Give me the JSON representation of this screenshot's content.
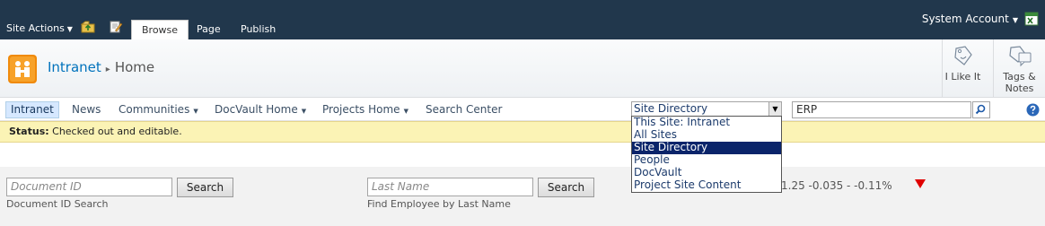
{
  "ribbon": {
    "site_actions": "Site Actions",
    "tabs": [
      "Browse",
      "Page",
      "Publish"
    ],
    "account": "System Account"
  },
  "title": {
    "site": "Intranet",
    "separator": "▸",
    "page": "Home",
    "i_like_it": "I Like It",
    "tags_notes": "Tags & Notes"
  },
  "nav": {
    "items": [
      "Intranet",
      "News",
      "Communities",
      "DocVault Home",
      "Projects Home",
      "Search Center"
    ]
  },
  "search": {
    "scope": "Site Directory",
    "query": "ERP",
    "options": [
      "This Site: Intranet",
      "All Sites",
      "Site Directory",
      "People",
      "DocVault",
      "Project Site Content"
    ]
  },
  "status": {
    "label": "Status:",
    "text": "Checked out and editable."
  },
  "content": {
    "doc_id_placeholder": "Document ID",
    "doc_id_button": "Search",
    "doc_id_hint": "Document ID Search",
    "emp_placeholder": "Last Name",
    "emp_button": "Search",
    "emp_hint": "Find Employee by Last Name",
    "ticker": "1.25 -0.035 - -0.11%"
  },
  "colors": {
    "ribbon_bg": "#21374c",
    "status_bg": "#fbf3b5",
    "selected_option": "#0a246a",
    "down_arrow": "#e00000"
  }
}
